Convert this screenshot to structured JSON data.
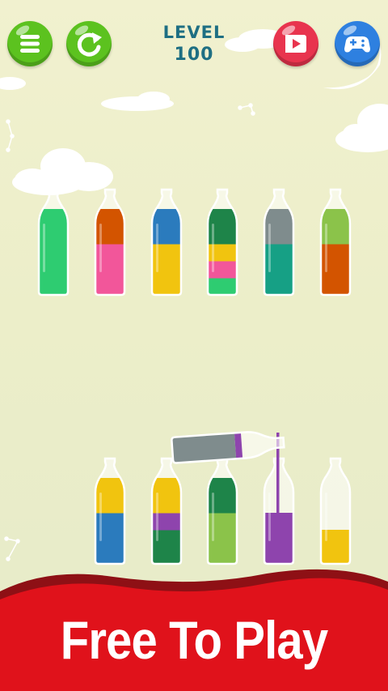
{
  "header": {
    "level_label": "LEVEL",
    "level_number": "100"
  },
  "buttons": [
    {
      "name": "menu-button",
      "icon": "menu-icon",
      "color": "#5cc21f"
    },
    {
      "name": "restart-button",
      "icon": "restart-icon",
      "color": "#5cc21f"
    },
    {
      "name": "video-button",
      "icon": "video-icon",
      "color": "#e8344e"
    },
    {
      "name": "games-button",
      "icon": "gamepad-icon",
      "color": "#2e80e0"
    }
  ],
  "top_row_bottles": [
    [
      "#2ecc71",
      "#2ecc71",
      "#2ecc71",
      "#2ecc71"
    ],
    [
      "#f2569a",
      "#f2569a",
      "#f2569a",
      "#d35400"
    ],
    [
      "#f1c40f",
      "#f1c40f",
      "#f1c40f",
      "#2b7bbd"
    ],
    [
      "#2ecc71",
      "#f2569a",
      "#f1c40f",
      "#1e8449"
    ],
    [
      "#16a085",
      "#16a085",
      "#16a085",
      "#7f8c8d"
    ],
    [
      "#d35400",
      "#d35400",
      "#d35400",
      "#8bc34a"
    ]
  ],
  "bottom_row_bottles": [
    [
      "#2b7bbd",
      "#2b7bbd",
      "#2b7bbd",
      "#f1c40f"
    ],
    [
      "#1e8449",
      "#1e8449",
      "#8e44ad",
      "#f1c40f"
    ],
    [
      "#8bc34a",
      "#8bc34a",
      "#8bc34a",
      "#1e8449"
    ],
    [
      "#8e44ad",
      "#8e44ad",
      "#8e44ad"
    ],
    [
      "#f1c40f",
      "#f1c40f"
    ]
  ],
  "pouring_bottle": {
    "colors": [
      "#7f8c8d",
      "#7f8c8d",
      "#7f8c8d",
      "#8e44ad"
    ],
    "stream_color": "#8e44ad"
  },
  "banner": {
    "text": "Free To Play",
    "color": "#e0121b"
  }
}
